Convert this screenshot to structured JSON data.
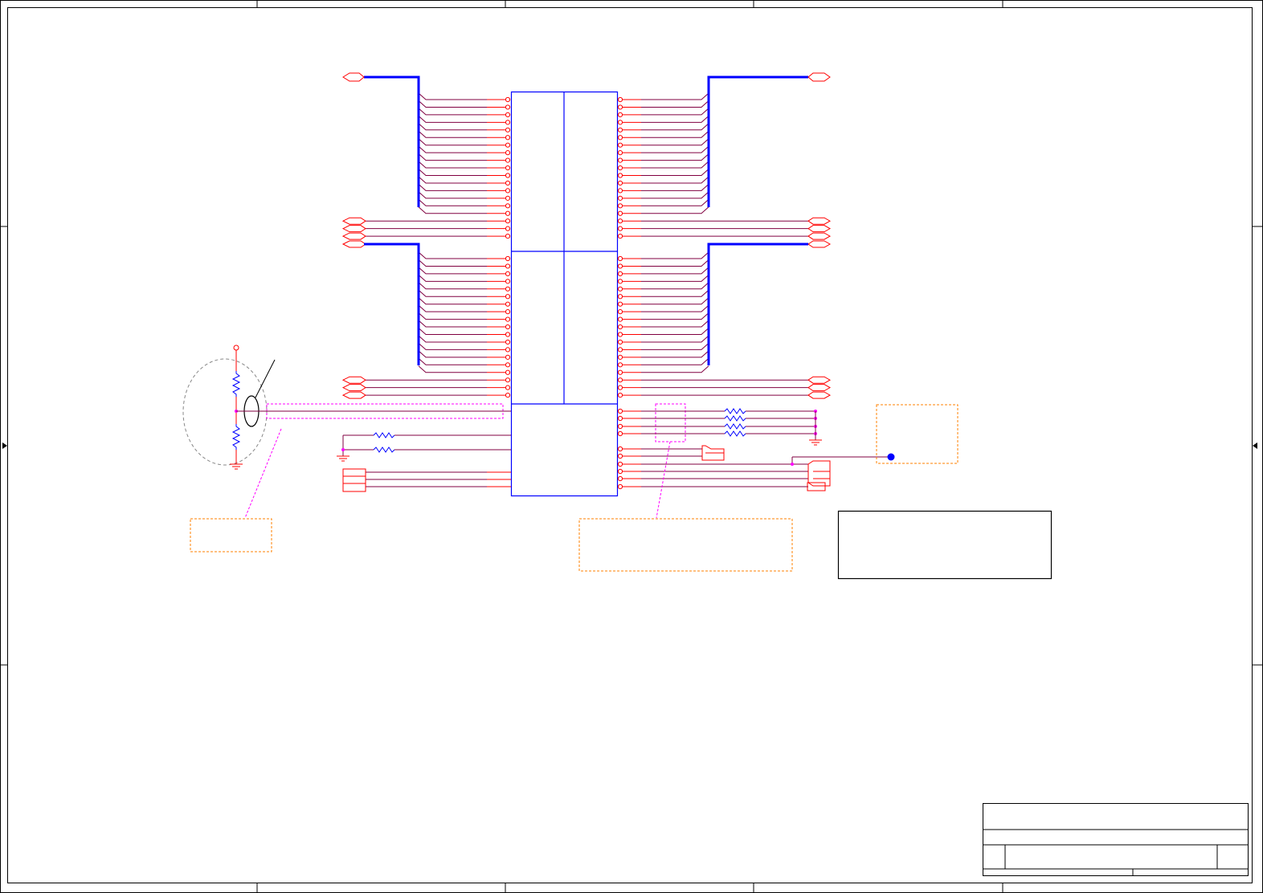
{
  "diagram": {
    "kind": "electrical schematic",
    "labels": [],
    "colors": {
      "border": "#000000",
      "component": "#0000ff",
      "bus": "#0000ff",
      "net_stub": "#ff0000",
      "wire": "#800040",
      "highlight": "#ff00ff",
      "annotation_box": "#ff8000",
      "ground": "#ff0000"
    }
  }
}
